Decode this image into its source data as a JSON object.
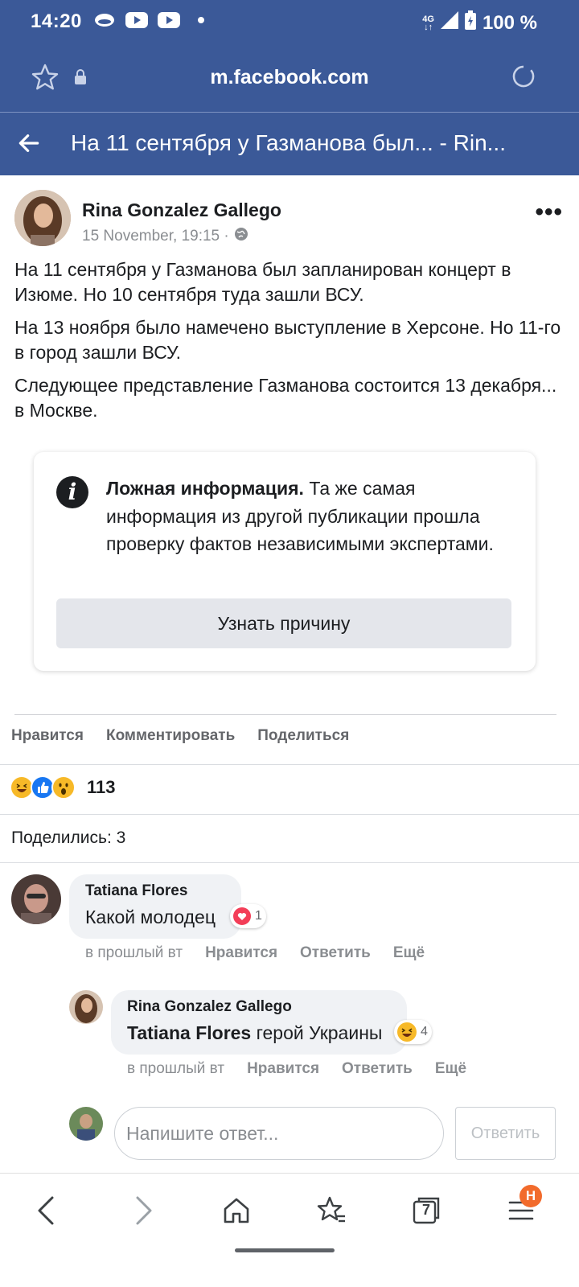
{
  "status_bar": {
    "time": "14:20",
    "network": "4G",
    "battery": "100 %",
    "icons": [
      "cloud-icon",
      "youtube-icon",
      "youtube-icon",
      "dot-icon",
      "signal-icon",
      "battery-icon"
    ]
  },
  "browser": {
    "url": "m.facebook.com"
  },
  "fb_header": {
    "title": "На 11 сентября у Газманова был... - Rin..."
  },
  "post": {
    "author": "Rina Gonzalez Gallego",
    "timestamp": "15 November, 19:15 ·",
    "paragraphs": [
      "На 11 сентября у Газманова был запланирован концерт в Изюме. Но 10 сентября туда зашли ВСУ.",
      "На 13 ноября было намечено выступление в Херсоне. Но 11-го в город зашли ВСУ.",
      "Следующее представление Газманова состоится 13 декабря... в Москве."
    ],
    "fact_check": {
      "title": "Ложная информация.",
      "text": " Та же самая информация из другой публикации прошла проверку фактов независимыми экспертами.",
      "button": "Узнать причину"
    },
    "actions": {
      "like": "Нравится",
      "comment": "Комментировать",
      "share": "Поделиться"
    },
    "reactions_count": "113",
    "shares": "Поделились: 3"
  },
  "comments": [
    {
      "author": "Tatiana Flores",
      "text": "Какой молодец",
      "reaction_count": "1",
      "time": "в прошлый вт",
      "like": "Нравится",
      "reply": "Ответить",
      "more": "Ещё"
    },
    {
      "author": "Rina Gonzalez Gallego",
      "mention": "Tatiana Flores",
      "text": " герой Украины",
      "reaction_count": "4",
      "time": "в прошлый вт",
      "like": "Нравится",
      "reply": "Ответить",
      "more": "Ещё"
    }
  ],
  "reply_box": {
    "placeholder": "Напишите ответ...",
    "submit": "Ответить"
  },
  "bottom_nav": {
    "tabs_count": "7",
    "menu_badge": "H"
  },
  "colors": {
    "facebook_blue": "#3b5998",
    "fb_link_blue": "#1877f2",
    "badge_orange": "#f26b2c"
  }
}
